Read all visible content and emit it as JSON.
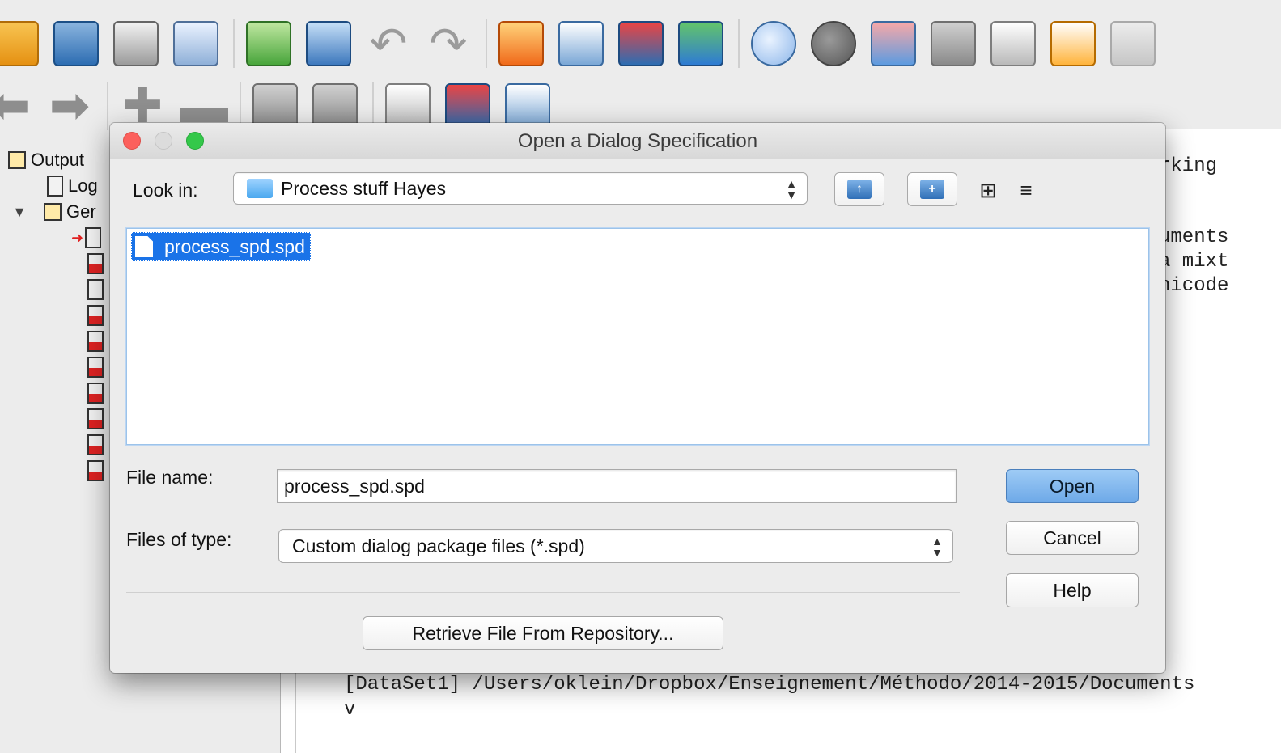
{
  "background": {
    "tree": {
      "items": [
        {
          "label": "Output"
        },
        {
          "label": "Log"
        },
        {
          "label": "Ger"
        }
      ]
    },
    "output_text": {
      "right_lines": [
        "rking",
        "uments",
        "a mixt",
        "nicode"
      ],
      "dataset_line": "[DataSet1] /Users/oklein/Dropbox/Enseignement/Méthodo/2014-2015/Documents",
      "v_line": "v"
    }
  },
  "dialog": {
    "title": "Open a Dialog Specification",
    "look_in": {
      "label": "Look in:",
      "value": "Process stuff Hayes"
    },
    "files": [
      {
        "name": "process_spd.spd",
        "selected": true
      }
    ],
    "file_name": {
      "label": "File name:",
      "value": "process_spd.spd"
    },
    "files_of_type": {
      "label": "Files of type:",
      "value": "Custom dialog package files (*.spd)"
    },
    "buttons": {
      "open": "Open",
      "cancel": "Cancel",
      "help": "Help",
      "retrieve": "Retrieve File From Repository..."
    }
  },
  "colors": {
    "selection": "#1a73e8",
    "primary_button": "#6ea9e8"
  }
}
